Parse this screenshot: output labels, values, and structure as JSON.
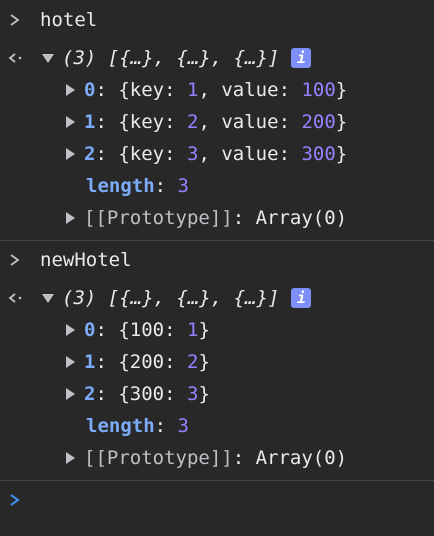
{
  "blocks": [
    {
      "command": "hotel",
      "summary": "(3) [{…}, {…}, {…}]",
      "items": [
        {
          "index": "0",
          "text": "{key: 1, value: 100}",
          "parts": [
            [
              "{",
              "white"
            ],
            [
              "key",
              "white"
            ],
            [
              ": ",
              "white"
            ],
            [
              "1",
              "num"
            ],
            [
              ", ",
              "white"
            ],
            [
              "value",
              "white"
            ],
            [
              ": ",
              "white"
            ],
            [
              "100",
              "num"
            ],
            [
              "}",
              "white"
            ]
          ]
        },
        {
          "index": "1",
          "text": "{key: 2, value: 200}",
          "parts": [
            [
              "{",
              "white"
            ],
            [
              "key",
              "white"
            ],
            [
              ": ",
              "white"
            ],
            [
              "2",
              "num"
            ],
            [
              ", ",
              "white"
            ],
            [
              "value",
              "white"
            ],
            [
              ": ",
              "white"
            ],
            [
              "200",
              "num"
            ],
            [
              "}",
              "white"
            ]
          ]
        },
        {
          "index": "2",
          "text": "{key: 3, value: 300}",
          "parts": [
            [
              "{",
              "white"
            ],
            [
              "key",
              "white"
            ],
            [
              ": ",
              "white"
            ],
            [
              "3",
              "num"
            ],
            [
              ", ",
              "white"
            ],
            [
              "value",
              "white"
            ],
            [
              ": ",
              "white"
            ],
            [
              "300",
              "num"
            ],
            [
              "}",
              "white"
            ]
          ]
        }
      ],
      "length_label": "length",
      "length_value": "3",
      "prototype_label": "[[Prototype]]",
      "prototype_value": "Array(0)"
    },
    {
      "command": "newHotel",
      "summary": "(3) [{…}, {…}, {…}]",
      "items": [
        {
          "index": "0",
          "text": "{100: 1}",
          "parts": [
            [
              "{",
              "white"
            ],
            [
              "100",
              "white"
            ],
            [
              ": ",
              "white"
            ],
            [
              "1",
              "num"
            ],
            [
              "}",
              "white"
            ]
          ]
        },
        {
          "index": "1",
          "text": "{200: 2}",
          "parts": [
            [
              "{",
              "white"
            ],
            [
              "200",
              "white"
            ],
            [
              ": ",
              "white"
            ],
            [
              "2",
              "num"
            ],
            [
              "}",
              "white"
            ]
          ]
        },
        {
          "index": "2",
          "text": "{300: 3}",
          "parts": [
            [
              "{",
              "white"
            ],
            [
              "300",
              "white"
            ],
            [
              ": ",
              "white"
            ],
            [
              "3",
              "num"
            ],
            [
              "}",
              "white"
            ]
          ]
        }
      ],
      "length_label": "length",
      "length_value": "3",
      "prototype_label": "[[Prototype]]",
      "prototype_value": "Array(0)"
    }
  ],
  "input_prompt": ">",
  "colors": {
    "background": "#282828",
    "key": "#7cacf8",
    "number": "#9980ff",
    "text": "#e8eaed",
    "info_badge": "#7e8ff7",
    "prompt": "#3b8eea"
  },
  "icons": {
    "input": "chevron-right-icon",
    "result": "return-arrow-icon",
    "expand": "triangle-down-icon",
    "collapse": "triangle-right-icon",
    "info": "info-icon"
  },
  "info_label": "i"
}
